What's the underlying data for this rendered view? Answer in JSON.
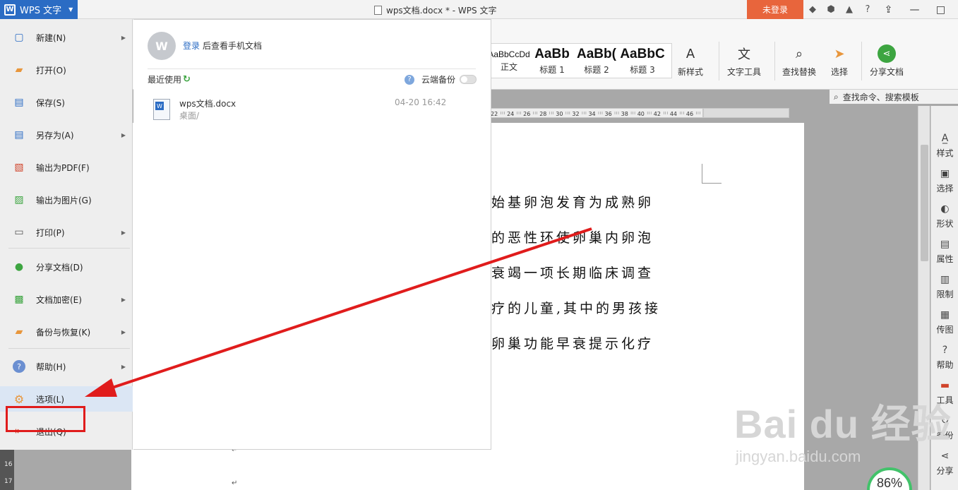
{
  "app": {
    "name": "WPS 文字",
    "window_title": "wps文档.docx * - WPS 文字",
    "login_button": "未登录"
  },
  "ribbon": {
    "styles": [
      "AaBbCcDd",
      "AaBb",
      "AaBb(",
      "AaBbC"
    ],
    "style_labels": [
      "正文",
      "标题 1",
      "标题 2",
      "标题 3"
    ],
    "buttons": [
      "新样式",
      "文字工具",
      "查找替换",
      "选择",
      "分享文档"
    ],
    "search_placeholder": "查找命令、搜索模板"
  },
  "ruler": {
    "ticks": [
      "22",
      "24",
      "26",
      "28",
      "30",
      "32",
      "34",
      "36",
      "38",
      "40",
      "42",
      "44",
      "46"
    ]
  },
  "menu": {
    "items": [
      {
        "label": "新建(N)",
        "icon": "new-doc-icon",
        "submenu": true
      },
      {
        "label": "打开(O)",
        "icon": "folder-open-icon",
        "submenu": false
      },
      {
        "label": "保存(S)",
        "icon": "save-icon",
        "submenu": false
      },
      {
        "label": "另存为(A)",
        "icon": "save-as-icon",
        "submenu": true
      },
      {
        "label": "输出为PDF(F)",
        "icon": "pdf-icon",
        "submenu": false
      },
      {
        "label": "输出为图片(G)",
        "icon": "image-export-icon",
        "submenu": false
      },
      {
        "label": "打印(P)",
        "icon": "print-icon",
        "submenu": true
      },
      {
        "label": "分享文档(D)",
        "icon": "share-icon",
        "submenu": false
      },
      {
        "label": "文档加密(E)",
        "icon": "encrypt-icon",
        "submenu": true
      },
      {
        "label": "备份与恢复(K)",
        "icon": "backup-icon",
        "submenu": true
      },
      {
        "label": "帮助(H)",
        "icon": "help-icon",
        "submenu": true
      },
      {
        "label": "选项(L)",
        "icon": "gear-icon",
        "submenu": false
      },
      {
        "label": "退出(Q)",
        "icon": "exit-icon",
        "submenu": false
      }
    ]
  },
  "recent": {
    "login_link": "登录",
    "login_text": "后查看手机文档",
    "title": "最近使用",
    "cloud_backup": "云端备份",
    "files": [
      {
        "name": "wps文档.docx",
        "path": "桌面/",
        "time": "04-20 16:42"
      }
    ]
  },
  "document": {
    "lines": [
      "始基卵泡发育为成熟卵",
      "的恶性环使卵巢内卵泡",
      "衰竭一项长期临床调查",
      "疗的儿童,其中的男孩接",
      "卵巢功能早衰提示化疗"
    ]
  },
  "right_panel": {
    "items": [
      "样式",
      "选择",
      "形状",
      "属性",
      "限制",
      "传图",
      "帮助",
      "工具",
      "备份",
      "分享"
    ]
  },
  "zoom": "86%",
  "watermark": {
    "brand": "Bai du 经验",
    "url": "jingyan.baidu.com"
  },
  "left_strip": [
    "16",
    "17"
  ],
  "colors": {
    "accent": "#2b6cc4",
    "login": "#e8653c",
    "annotation": "#e01c1c",
    "zoom_ring": "#42c26a"
  }
}
